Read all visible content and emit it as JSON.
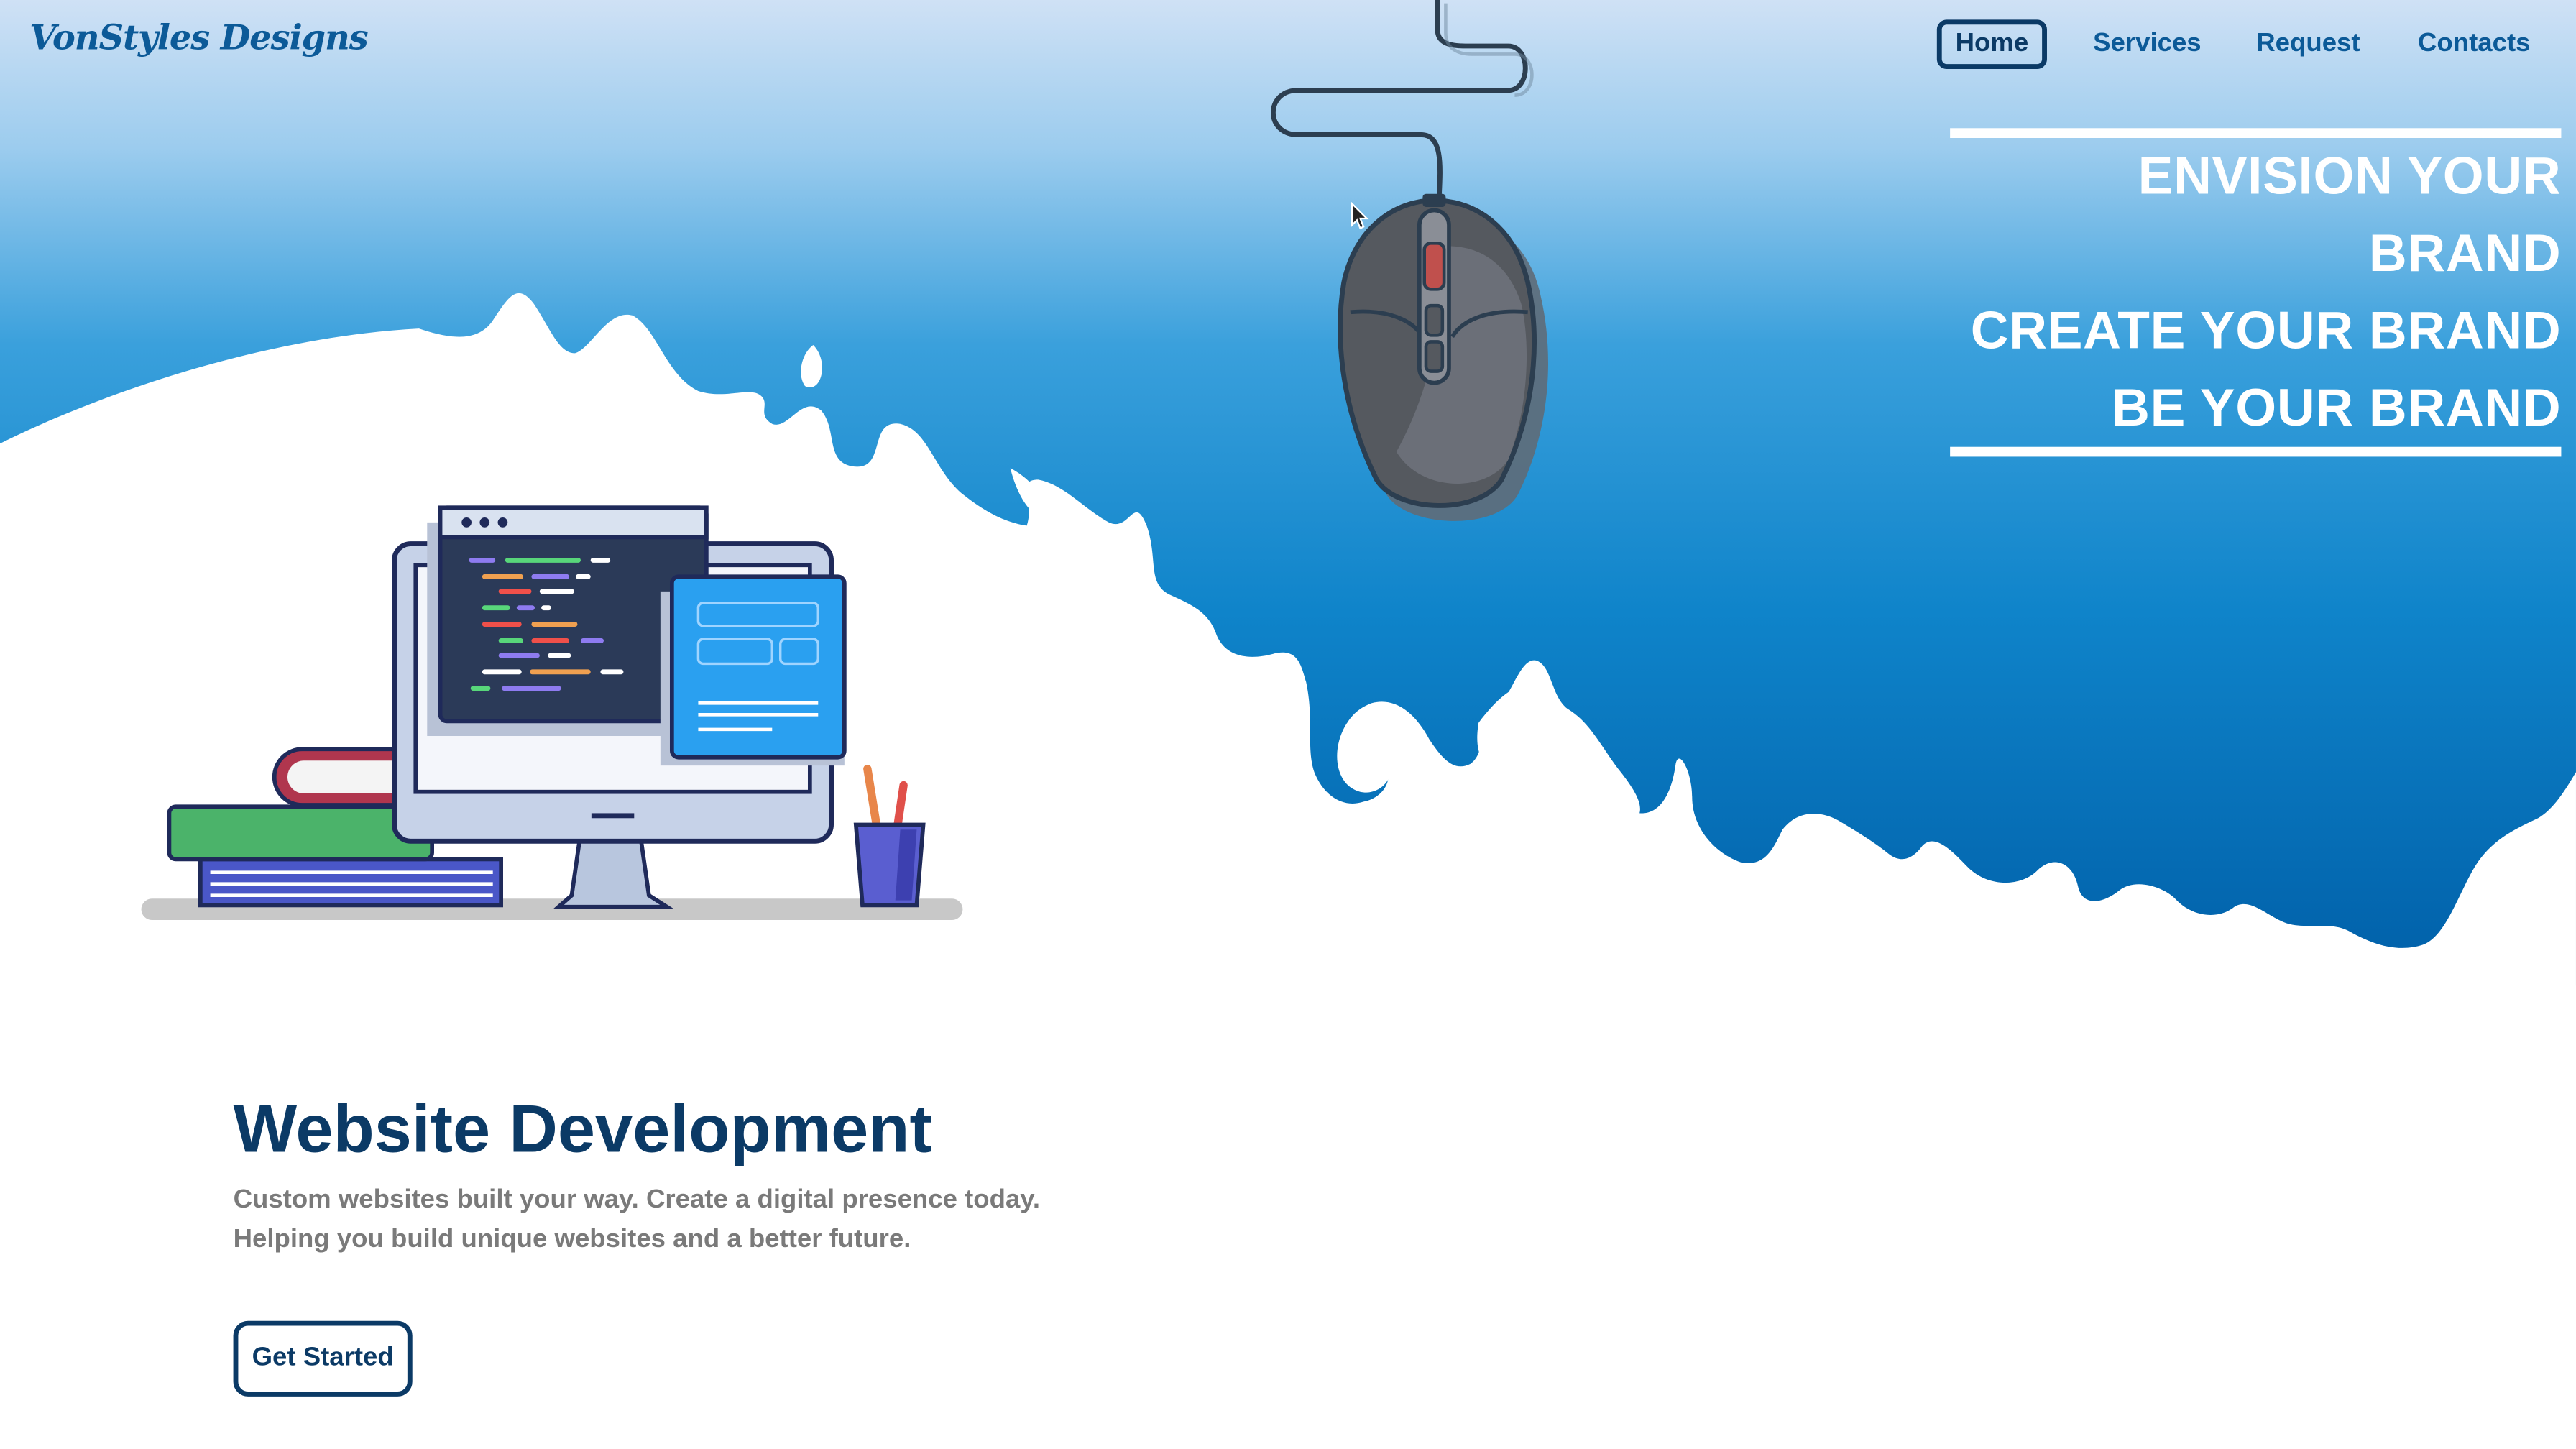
{
  "brand": {
    "logo_text": "VonStyles Designs"
  },
  "nav": {
    "items": [
      {
        "label": "Home",
        "active": true
      },
      {
        "label": "Services",
        "active": false
      },
      {
        "label": "Request",
        "active": false
      },
      {
        "label": "Contacts",
        "active": false
      }
    ]
  },
  "hero": {
    "taglines": [
      "ENVISION YOUR BRAND",
      "CREATE YOUR BRAND",
      "BE YOUR BRAND"
    ],
    "title": "Website Development",
    "subtitle_lines": [
      "Custom websites built your way. Create a digital presence today.",
      "Helping you build unique websites and a better future."
    ],
    "cta_label": "Get Started"
  },
  "icons": [
    "computer-illustration",
    "mouse-illustration",
    "cursor-icon"
  ],
  "colors": {
    "primary_navy": "#0b3a66",
    "brand_blue": "#0c5a98",
    "sky_top": "#cfe1f5",
    "sky_bottom": "#0060aa",
    "subtitle_gray": "#7a7a7a"
  }
}
